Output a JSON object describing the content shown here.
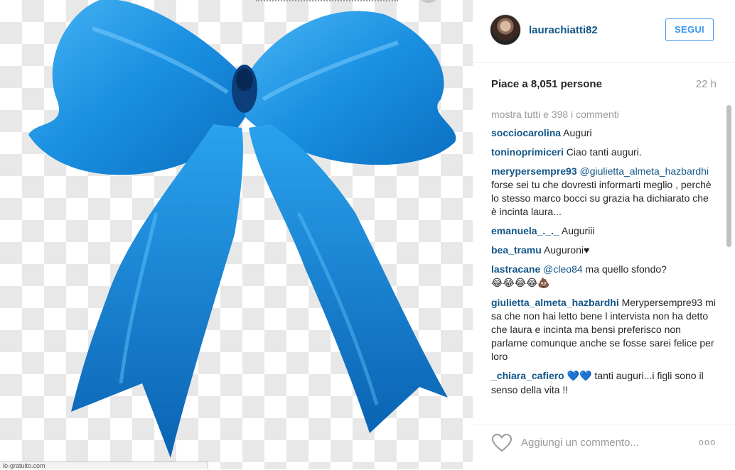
{
  "post": {
    "image_alt": "blue ribbon bow",
    "status_url": "lo-gratuito.com"
  },
  "colors": {
    "ribbon": "#1a8fe0",
    "link": "#125688",
    "follow": "#3897f0"
  },
  "header": {
    "username": "laurachiatti82",
    "follow_label": "SEGUI"
  },
  "stats": {
    "likes": "Piace a 8,051 persone",
    "time": "22 h"
  },
  "comments": {
    "view_all": "mostra tutti e 398 i commenti",
    "items": [
      {
        "user": "socciocarolina",
        "text": "Auguri"
      },
      {
        "user": "toninoprimiceri",
        "text": "Ciao tanti auguri."
      },
      {
        "user": "merypersempre93",
        "mention": "@giulietta_almeta_hazbardhi",
        "text": "forse sei tu che dovresti informarti meglio , perchè lo stesso marco bocci su grazia ha dichiarato che è incinta laura..."
      },
      {
        "user": "emanuela_._._",
        "text": "Auguriii"
      },
      {
        "user": "bea_tramu",
        "text": "Auguroni♥"
      },
      {
        "user": "lastracane",
        "mention": "@cleo84",
        "text": "ma quello sfondo?",
        "emoji": "😂😂😂😂💩"
      },
      {
        "user": "giulietta_almeta_hazbardhi",
        "text": "Merypersempre93 mi sa che non hai letto bene l intervista non ha detto che laura e incinta ma bensi preferisco non parlarne comunque anche se fosse sarei felice per loro"
      },
      {
        "user": "_chiara_cafiero",
        "emoji": "💙💙",
        "text": "tanti auguri...i figli sono il senso della vita !!"
      }
    ]
  },
  "footer": {
    "add_comment_placeholder": "Aggiungi un commento...",
    "more_label": "ooo",
    "heart_icon": "heart-outline-icon"
  }
}
